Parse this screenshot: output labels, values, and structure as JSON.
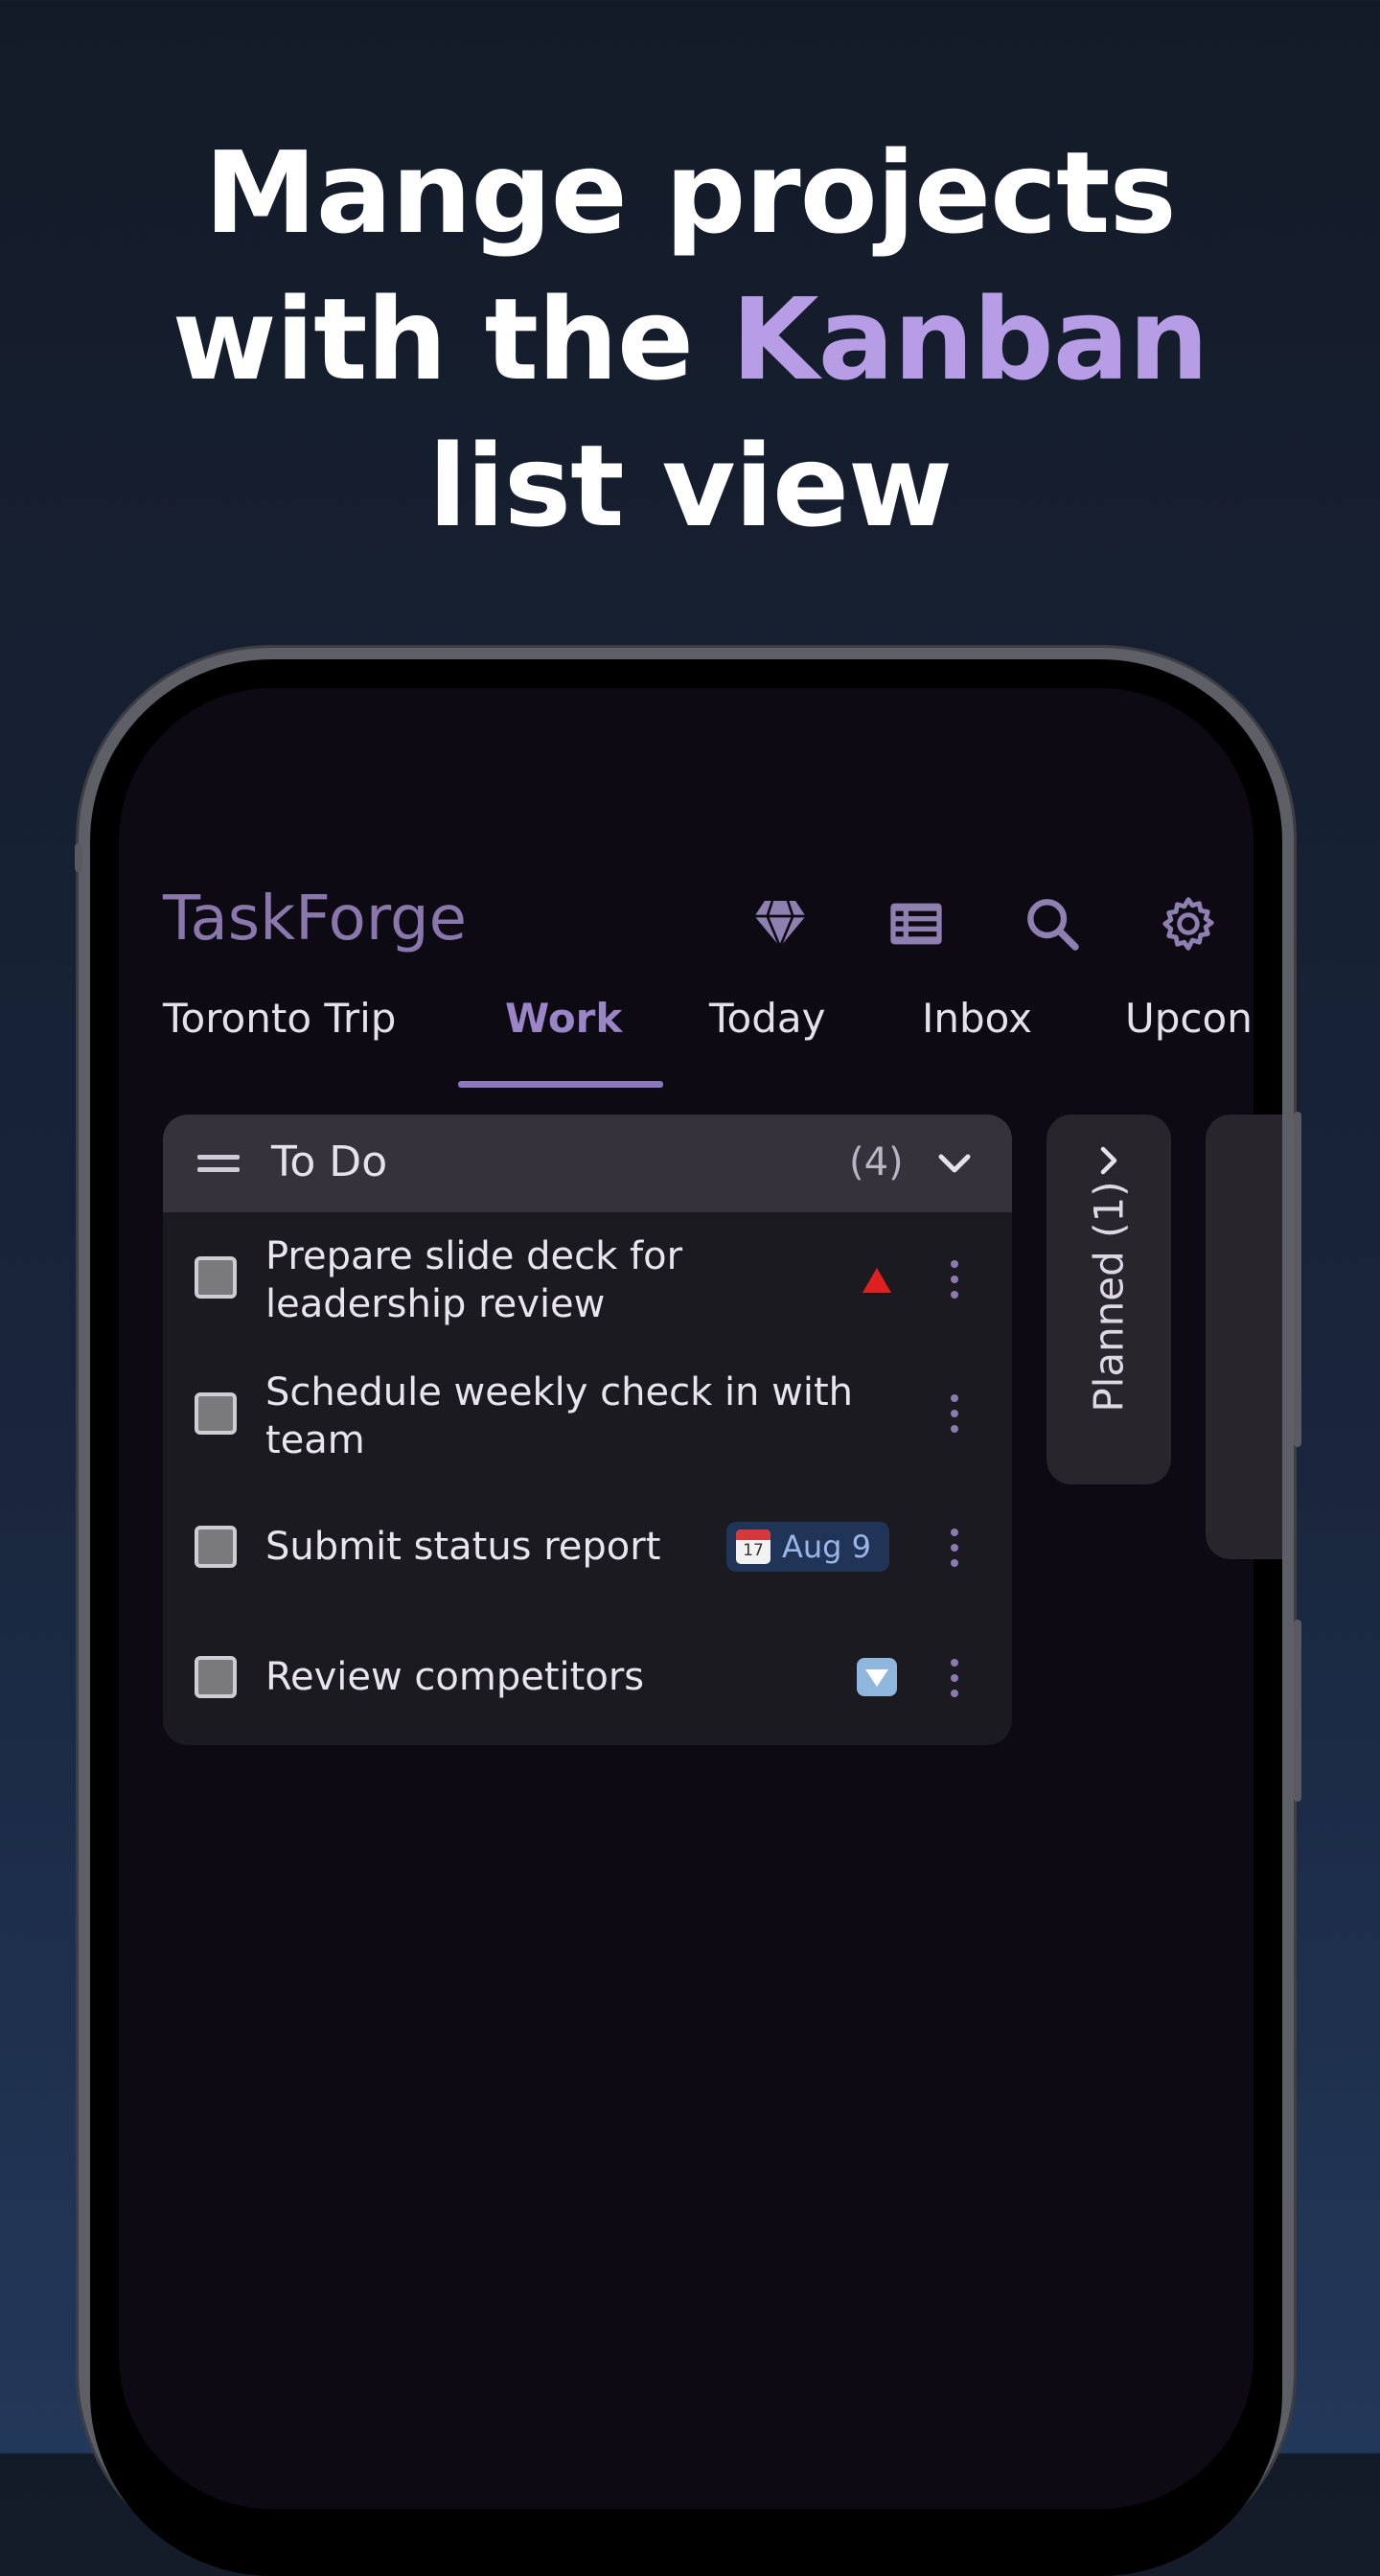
{
  "headline": {
    "line1": "Mange projects",
    "line2_prefix": "with the ",
    "line2_highlight": "Kanban",
    "line3": "list view"
  },
  "app": {
    "title": "TaskForge",
    "icons": [
      "diamond-icon",
      "list-view-icon",
      "search-icon",
      "settings-gear-icon"
    ]
  },
  "tabs": [
    {
      "label": "Toronto Trip",
      "active": false
    },
    {
      "label": "Work",
      "active": true
    },
    {
      "label": "Today",
      "active": false
    },
    {
      "label": "Inbox",
      "active": false
    },
    {
      "label": "Upcon",
      "active": false
    }
  ],
  "column": {
    "title": "To Do",
    "count": "(4)",
    "tasks": [
      {
        "line1": "Prepare slide deck for",
        "line2": "leadership review",
        "badge": "priority-high"
      },
      {
        "line1": "Schedule weekly check in with",
        "line2": "team",
        "badge": null
      },
      {
        "line1": "Submit status report",
        "badge": "date",
        "date_label": "Aug 9",
        "calendar_day": "17"
      },
      {
        "line1": "Review competitors",
        "badge": "priority-low"
      }
    ]
  },
  "collapsed_column": {
    "label": "Planned (1)"
  },
  "colors": {
    "accent": "#9a86c6",
    "highlight": "#b79de6",
    "priority_high": "#e01f1f",
    "date_chip_bg": "#1f3456"
  }
}
